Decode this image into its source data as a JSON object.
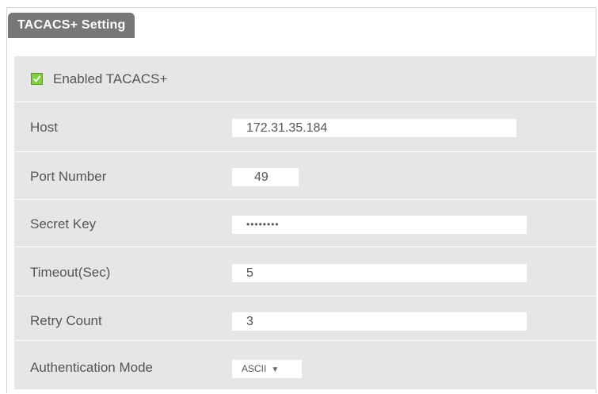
{
  "section": {
    "title": "TACACS+ Setting"
  },
  "enable": {
    "label": "Enabled TACACS+",
    "checked": true
  },
  "fields": {
    "host": {
      "label": "Host",
      "value": "172.31.35.184"
    },
    "port": {
      "label": "Port Number",
      "value": "49"
    },
    "secret": {
      "label": "Secret Key",
      "value": "••••••••"
    },
    "timeout": {
      "label": "Timeout(Sec)",
      "value": "5"
    },
    "retry": {
      "label": "Retry Count",
      "value": "3"
    },
    "auth_mode": {
      "label": "Authentication Mode",
      "value": "ASCII",
      "arrow": "▼"
    }
  },
  "colors": {
    "tab": "#777777",
    "panel": "#e6e6e6",
    "checkbox": "#7fd03a"
  }
}
